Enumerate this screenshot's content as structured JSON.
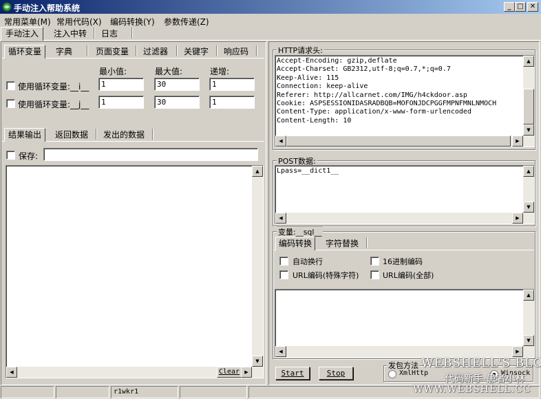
{
  "window": {
    "title": "手动注入帮助系统",
    "min": "_",
    "max": "□",
    "close": "✕"
  },
  "menu": [
    "常用菜单(M)",
    "常用代码(X)",
    "编码转换(Y)",
    "参数传递(Z)"
  ],
  "main_tabs": [
    "手动注入",
    "注入中转",
    "日志"
  ],
  "sub_tabs": [
    "循环变量",
    "字典",
    "页面变量",
    "过滤器",
    "关键字",
    "响应码"
  ],
  "loop": {
    "col_min": "最小值:",
    "col_max": "最大值:",
    "col_step": "递增:",
    "rows": [
      {
        "label": "使用循环变量:__i__",
        "min": "1",
        "max": "30",
        "step": "1"
      },
      {
        "label": "使用循环变量:__j__",
        "min": "1",
        "max": "30",
        "step": "1"
      }
    ]
  },
  "out_tabs": [
    "结果输出",
    "返回数据",
    "发出的数据"
  ],
  "save": {
    "label": "保存:",
    "value": ""
  },
  "clear_label": "Clear",
  "http": {
    "title": "HTTP请求头:",
    "lines": [
      "Accept-Encoding: gzip,deflate",
      "Accept-Charset: GB2312,utf-8;q=0.7,*;q=0.7",
      "Keep-Alive: 115",
      "Connection: keep-alive",
      "Referer: http://allcarnet.com/IMG/h4ckdoor.asp",
      "Cookie: ASPSESSIONIDASRADBQB=MOFONJDCPGGFMPNFMNLNMOCH",
      "Content-Type: application/x-www-form-urlencoded",
      "Content-Length: 10"
    ]
  },
  "post": {
    "title": "POST数据:",
    "value": "Lpass=__dict1__"
  },
  "var": {
    "title": "变量:__sql__",
    "tabs": [
      "编码转换",
      "字符替换"
    ],
    "options": [
      "自动换行",
      "16进制编码",
      "URL编码(特殊字符)",
      "URL编码(全部)"
    ]
  },
  "buttons": {
    "start": "Start",
    "stop": "Stop"
  },
  "send_method": {
    "title": "发包方法",
    "options": [
      "XmlHttp",
      "Winsock"
    ]
  },
  "status": [
    "",
    "",
    "r1wkr1",
    "",
    ""
  ],
  "watermark": {
    "line1": "WEBSHELL'S BLOG",
    "line2": "代码新手·患者小林",
    "line3": "WWW.WEBSHELL.CC"
  }
}
